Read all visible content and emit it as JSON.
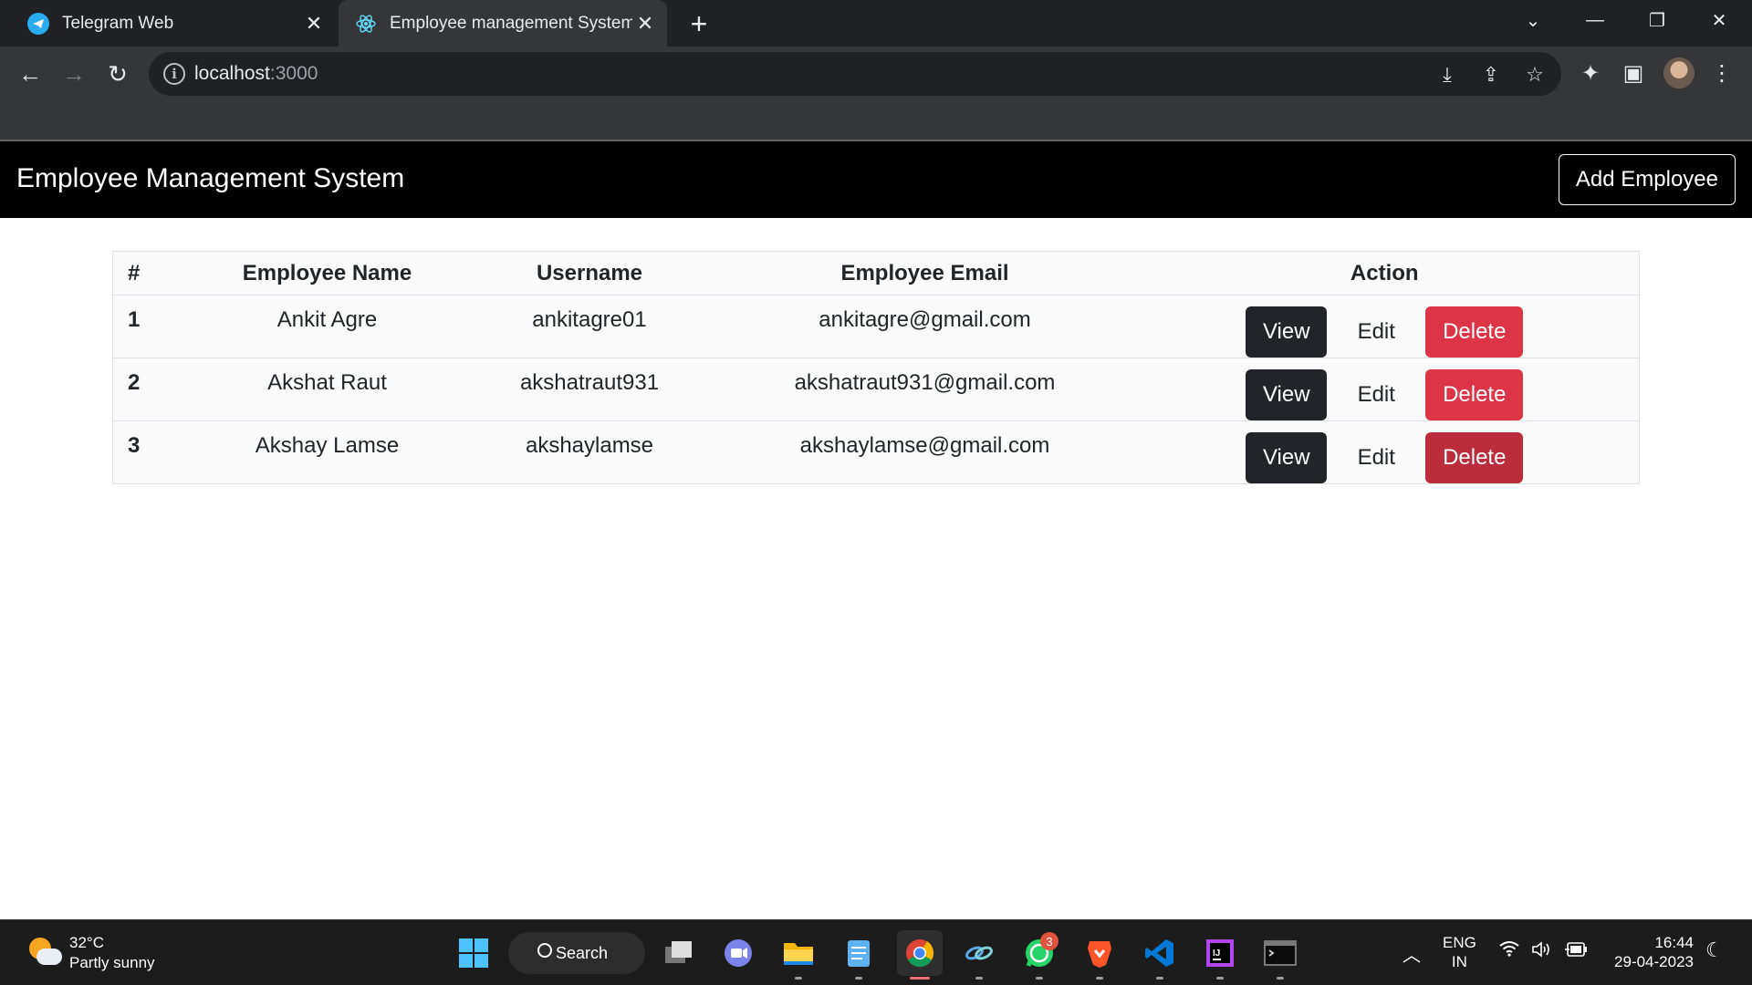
{
  "browser": {
    "tabs": [
      {
        "title": "Telegram Web",
        "icon": "telegram-icon"
      },
      {
        "title": "Employee management System",
        "icon": "react-icon"
      }
    ],
    "url_host": "localhost",
    "url_port": ":3000"
  },
  "app": {
    "brand": "Employee Management System",
    "add_button": "Add Employee",
    "columns": [
      "#",
      "Employee Name",
      "Username",
      "Employee Email",
      "Action"
    ],
    "rows": [
      {
        "id": "1",
        "name": "Ankit Agre",
        "username": "ankitagre01",
        "email": "ankitagre@gmail.com"
      },
      {
        "id": "2",
        "name": "Akshat Raut",
        "username": "akshatraut931",
        "email": "akshatraut931@gmail.com"
      },
      {
        "id": "3",
        "name": "Akshay Lamse",
        "username": "akshaylamse",
        "email": "akshaylamse@gmail.com"
      }
    ],
    "actions": {
      "view": "View",
      "edit": "Edit",
      "delete": "Delete"
    },
    "colors": {
      "navbar": "#000000",
      "view": "#212529",
      "delete": "#dc3545",
      "delete_hover": "#bb2d3b"
    }
  },
  "taskbar": {
    "weather_temp": "32°C",
    "weather_desc": "Partly sunny",
    "search_label": "Search",
    "whatsapp_badge": "3",
    "lang_top": "ENG",
    "lang_bottom": "IN",
    "time": "16:44",
    "date": "29-04-2023"
  }
}
